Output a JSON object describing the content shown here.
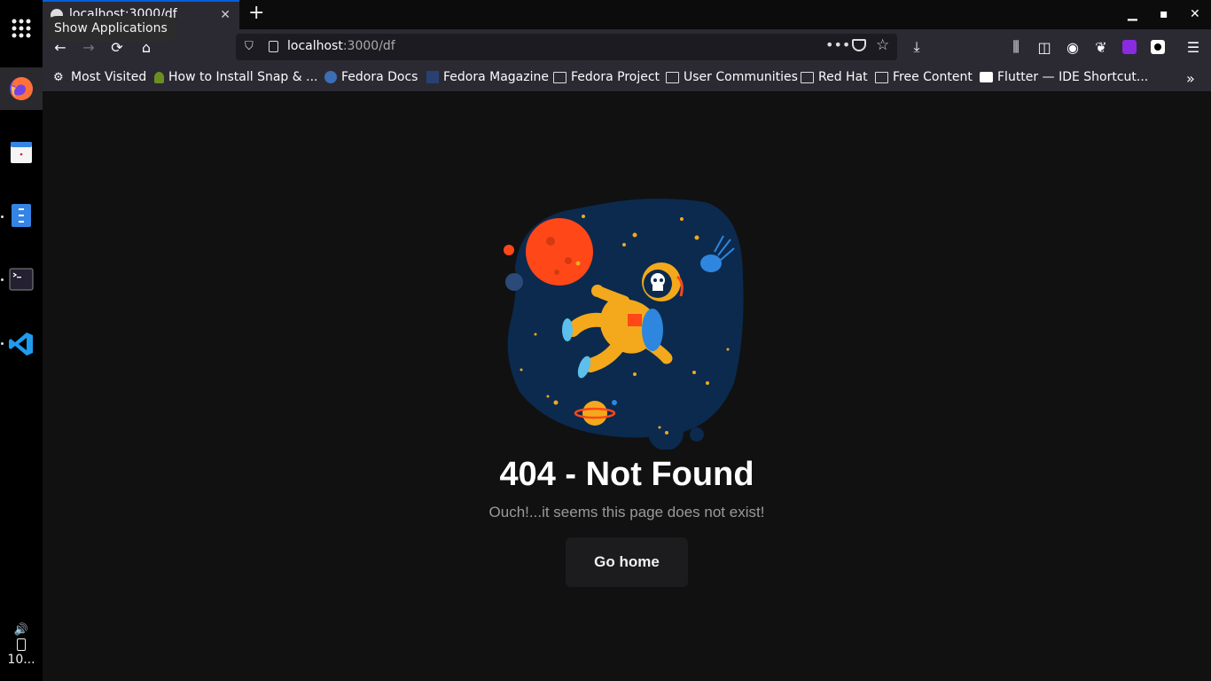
{
  "dock": {
    "tooltip": "Show Applications",
    "status_time": "10..."
  },
  "browser": {
    "tab_title": "localhost:3000/df",
    "url_host": "localhost",
    "url_path": ":3000/df",
    "bookmarks": [
      "Most Visited",
      "How to Install Snap & ...",
      "Fedora Docs",
      "Fedora Magazine",
      "Fedora Project",
      "User Communities",
      "Red Hat",
      "Free Content",
      "Flutter — IDE Shortcut..."
    ]
  },
  "page": {
    "title": "404 - Not Found",
    "subtitle": "Ouch!...it seems this page does not exist!",
    "button_label": "Go home"
  },
  "colors": {
    "page_bg": "#111112",
    "chrome_bg": "#2b2a33",
    "blob": "#0b2a4e",
    "suit": "#f3a91b",
    "planet_red": "#ff4718"
  }
}
